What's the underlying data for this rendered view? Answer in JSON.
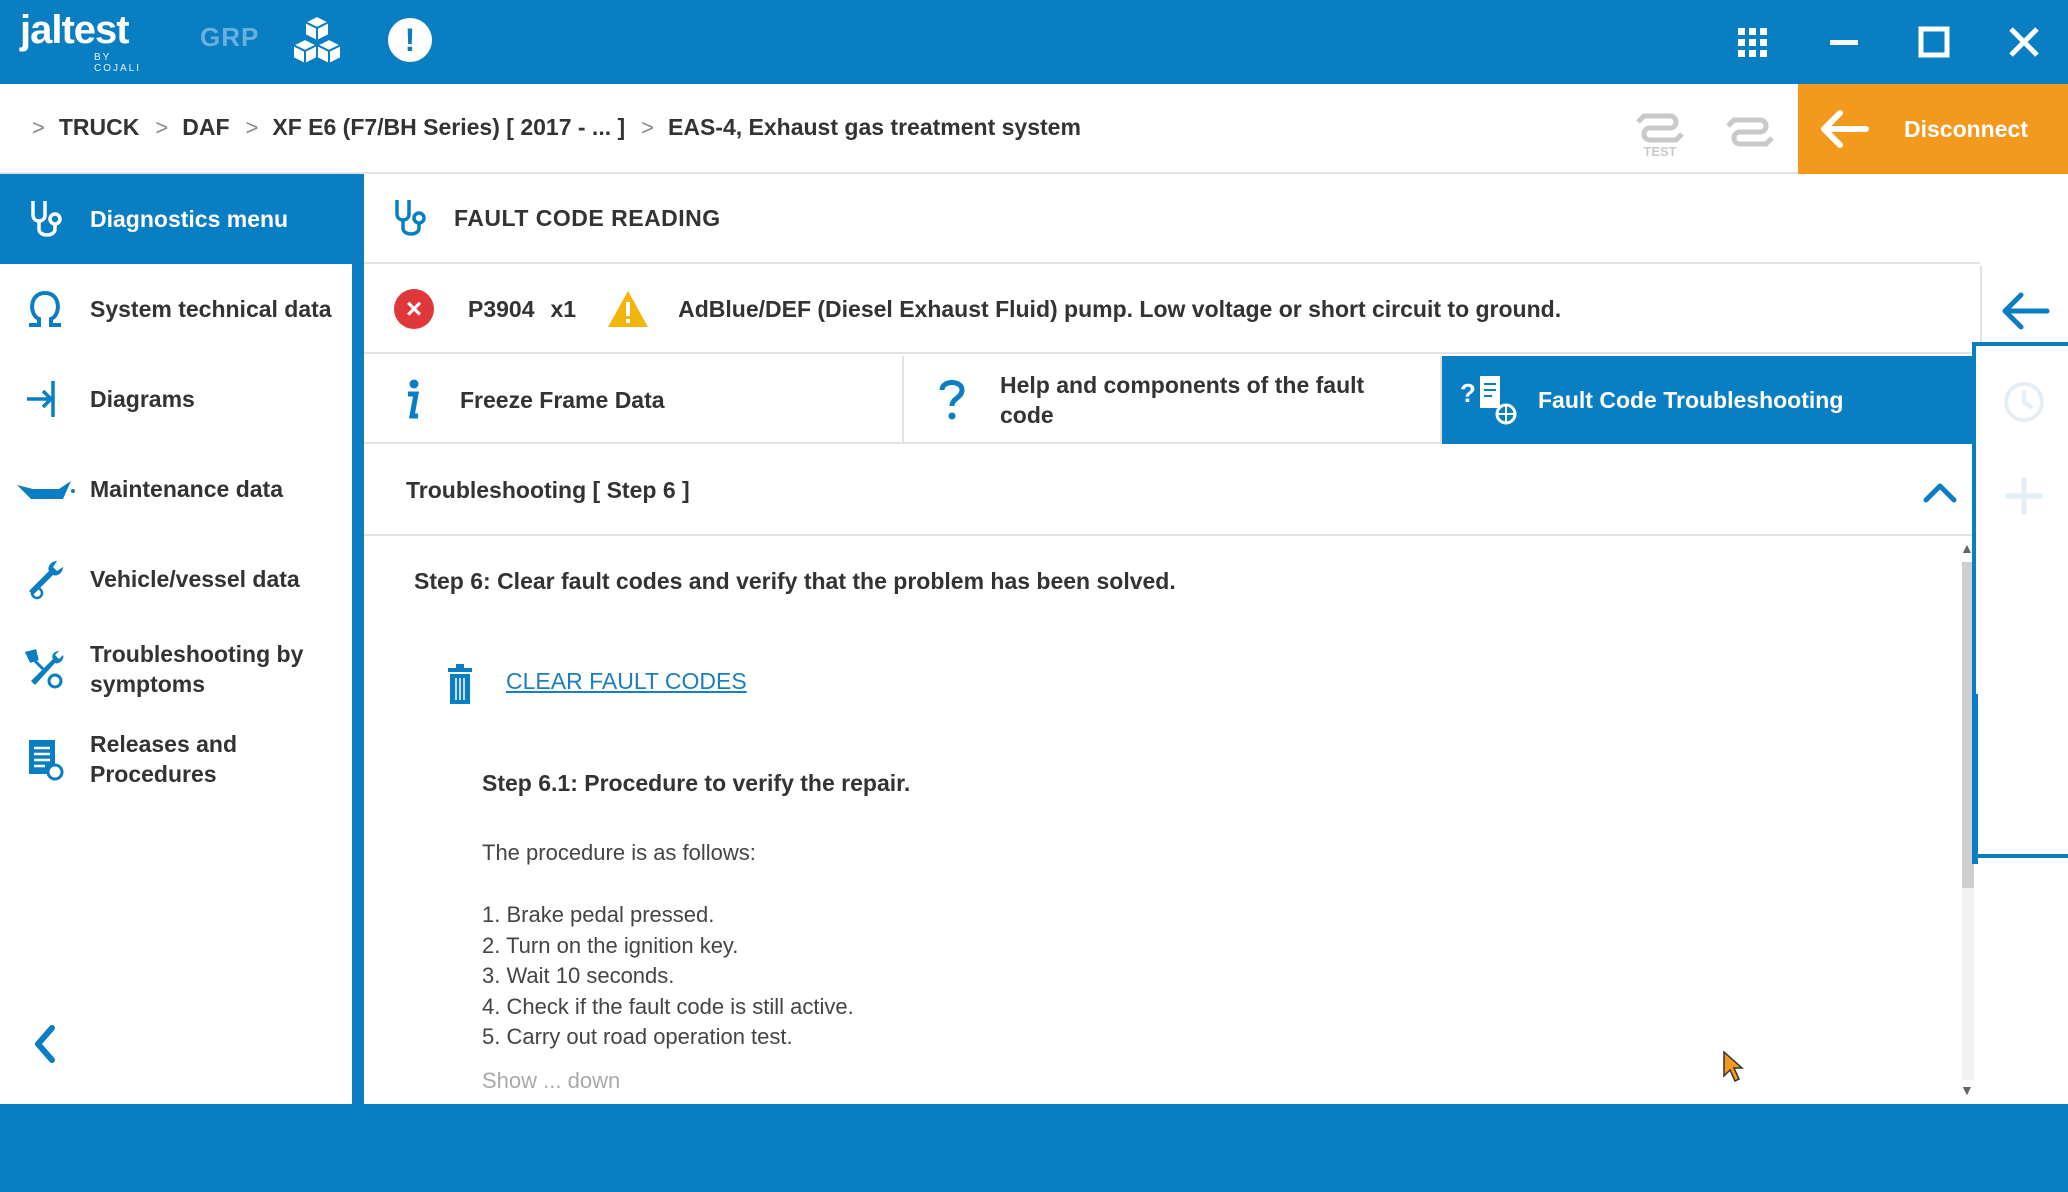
{
  "app": {
    "logo_text": "jaltest",
    "logo_sub": "BY COJALI",
    "grp_label": "GRP"
  },
  "breadcrumb": [
    "TRUCK",
    "DAF",
    "XF E6 (F7/BH Series) [ 2017 - ... ]",
    "EAS-4, Exhaust gas treatment system"
  ],
  "toolbar": {
    "disconnect_label": "Disconnect",
    "test_label": "TEST"
  },
  "sidebar": {
    "active_label": "Diagnostics menu",
    "items": [
      {
        "label": "System technical data",
        "icon": "omega-icon"
      },
      {
        "label": "Diagrams",
        "icon": "diagram-icon"
      },
      {
        "label": "Maintenance data",
        "icon": "oil-can-icon"
      },
      {
        "label": "Vehicle/vessel data",
        "icon": "wrench-icon"
      },
      {
        "label": "Troubleshooting by symptoms",
        "icon": "tools-icon"
      },
      {
        "label": "Releases and Procedures",
        "icon": "document-icon"
      }
    ]
  },
  "main": {
    "header_title": "FAULT CODE READING",
    "fault": {
      "code": "P3904",
      "count": "x1",
      "description": "AdBlue/DEF (Diesel Exhaust Fluid) pump. Low voltage or short circuit to ground."
    },
    "tabs": [
      {
        "label": "Freeze Frame Data",
        "icon": "info-icon"
      },
      {
        "label": "Help and components of the fault code",
        "icon": "question-icon"
      },
      {
        "label": "Fault Code Troubleshooting",
        "icon": "troubleshoot-icon"
      }
    ],
    "section_title": "Troubleshooting [ Step 6 ]",
    "step_title": "Step 6: Clear fault codes and verify that the problem has been solved.",
    "clear_link": "CLEAR FAULT CODES",
    "sub_title": "Step 6.1: Procedure to verify the repair.",
    "procedure_intro": "The procedure is as follows:",
    "procedure_steps": [
      "1. Brake pedal pressed.",
      "2. Turn on the ignition key.",
      "3. Wait 10 seconds.",
      "4. Check if the fault code is still active.",
      "5. Carry out road operation test."
    ],
    "faded_text": "Show ... down"
  },
  "colors": {
    "primary": "#0a7ec2",
    "accent": "#f39a1e",
    "error": "#e0383a",
    "warning": "#f2b50c"
  }
}
